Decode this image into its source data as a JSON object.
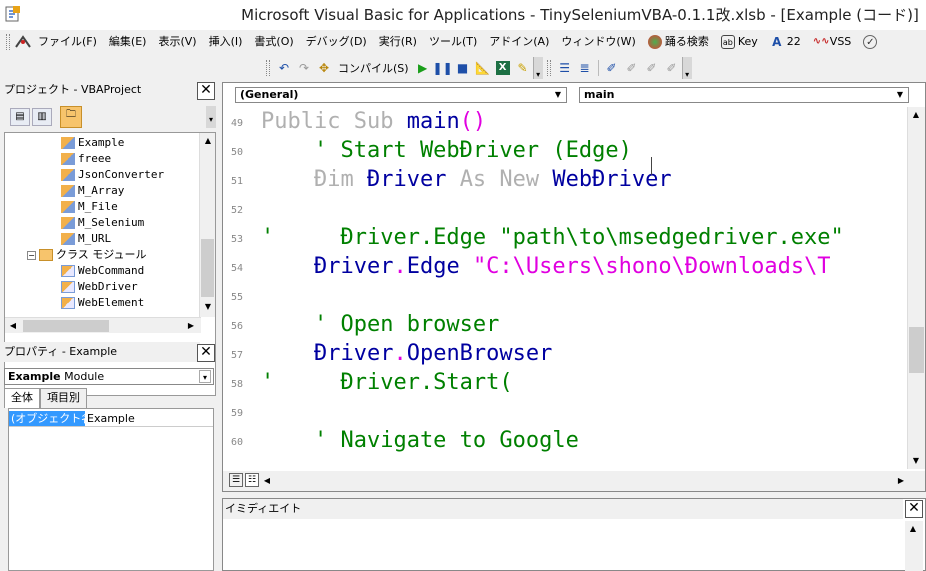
{
  "window": {
    "title": "Microsoft Visual Basic for Applications - TinySeleniumVBA-0.1.1改.xlsb - [Example (コード)]"
  },
  "menubar": {
    "items": [
      "ファイル(F)",
      "編集(E)",
      "表示(V)",
      "挿入(I)",
      "書式(O)",
      "デバッグ(D)",
      "実行(R)",
      "ツール(T)",
      "アドイン(A)",
      "ウィンドウ(W)"
    ],
    "extras": {
      "odoru_label": "踊る検索",
      "key_label": "Key",
      "font_size": "22",
      "vss_label": "VSS"
    }
  },
  "toolbar": {
    "compile_label": "コンパイル(S)"
  },
  "project": {
    "title": "プロジェクト - VBAProject",
    "modules": [
      "Example",
      "freee",
      "JsonConverter",
      "M_Array",
      "M_File",
      "M_Selenium",
      "M_URL"
    ],
    "class_folder": "クラス モジュール",
    "classes": [
      "WebCommand",
      "WebDriver",
      "WebElement"
    ]
  },
  "properties": {
    "title": "プロパティ - Example",
    "object_name": "Example",
    "object_type": "Module",
    "tabs": [
      "全体",
      "項目別"
    ],
    "row_key": "(オブジェクト名)",
    "row_value": "Example"
  },
  "code": {
    "object_combo": "(General)",
    "proc_combo": "main",
    "lines": [
      {
        "num": "49",
        "tokens": [
          {
            "t": "Public Sub ",
            "c": "kwg"
          },
          {
            "t": "main",
            "c": "kw"
          },
          {
            "t": "()",
            "c": "pn"
          }
        ]
      },
      {
        "num": "50",
        "tokens": [
          {
            "t": "    ' Start WebĐriver (Edge)",
            "c": "cm"
          }
        ]
      },
      {
        "num": "51",
        "tokens": [
          {
            "t": "    Đim ",
            "c": "kwg"
          },
          {
            "t": "Đriver ",
            "c": "kw"
          },
          {
            "t": "As New ",
            "c": "kwg"
          },
          {
            "t": "WebĐriver",
            "c": "kw"
          }
        ]
      },
      {
        "num": "52",
        "tokens": []
      },
      {
        "num": "53",
        "tokens": [
          {
            "t": "'     Đriver.Edge \"path\\to\\msedgedriver.exe\"",
            "c": "cm"
          }
        ]
      },
      {
        "num": "54",
        "tokens": [
          {
            "t": "    Đriver",
            "c": "kw"
          },
          {
            "t": ".",
            "c": "pn"
          },
          {
            "t": "Edge ",
            "c": "kw"
          },
          {
            "t": "\"C:\\Users\\shono\\Đownloads\\T",
            "c": "st"
          }
        ]
      },
      {
        "num": "55",
        "tokens": []
      },
      {
        "num": "56",
        "tokens": [
          {
            "t": "    ' Open browser",
            "c": "cm"
          }
        ]
      },
      {
        "num": "57",
        "tokens": [
          {
            "t": "    Đriver",
            "c": "kw"
          },
          {
            "t": ".",
            "c": "pn"
          },
          {
            "t": "OpenBrowser",
            "c": "kw"
          }
        ]
      },
      {
        "num": "58",
        "tokens": [
          {
            "t": "'     Đriver.Start(",
            "c": "cm"
          }
        ]
      },
      {
        "num": "59",
        "tokens": []
      },
      {
        "num": "60",
        "tokens": [
          {
            "t": "    ' Navigate to Google",
            "c": "cm"
          }
        ]
      }
    ]
  },
  "immediate": {
    "title": "イミディエイト"
  },
  "colors": {
    "keyword": "#0000a0",
    "comment": "#008000",
    "string": "#e000e0",
    "selection": "#3399ff"
  }
}
